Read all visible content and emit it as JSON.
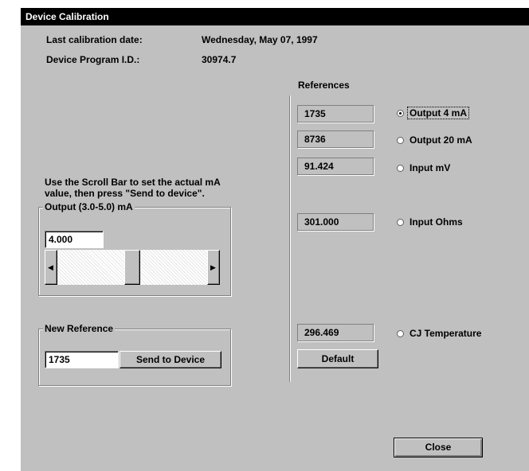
{
  "window": {
    "title": "Device Calibration"
  },
  "info": {
    "last_cal_label": "Last calibration date:",
    "last_cal_value": "Wednesday, May 07, 1997",
    "program_id_label": "Device Program I.D.:",
    "program_id_value": "30974.7"
  },
  "instructions": {
    "line1": "Use the Scroll Bar to set the actual mA",
    "line2": "value, then press \"Send to device\"."
  },
  "output_group": {
    "label": "Output (3.0-5.0) mA",
    "value": "4.000",
    "scroll_level_percent": 50
  },
  "new_reference_group": {
    "label": "New Reference",
    "value": "1735",
    "send_button": "Send to Device"
  },
  "references": {
    "label": "References",
    "rows": [
      {
        "value": "1735",
        "option": "Output 4 mA",
        "selected": true
      },
      {
        "value": "8736",
        "option": "Output 20 mA",
        "selected": false
      },
      {
        "value": "91.424",
        "option": "Input mV",
        "selected": false
      },
      {
        "value": "301.000",
        "option": "Input Ohms",
        "selected": false
      },
      {
        "value": "296.469",
        "option": "CJ Temperature",
        "selected": false
      }
    ],
    "default_button": "Default"
  },
  "close_button": "Close",
  "icons": {
    "scroll_left": "arrow-left-icon",
    "scroll_right": "arrow-right-icon"
  },
  "colors": {
    "face": "#c0c0c0",
    "titlebar": "#000000"
  }
}
